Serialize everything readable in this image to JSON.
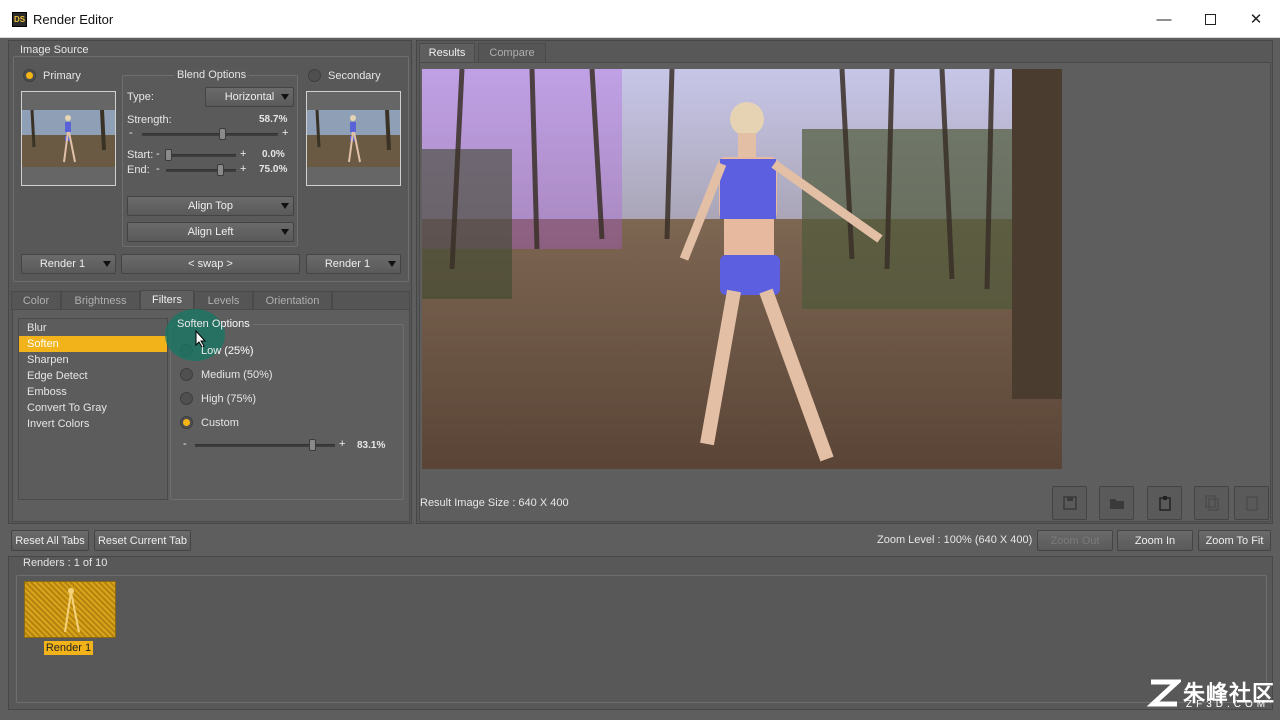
{
  "window": {
    "title": "Render Editor",
    "icon_text": "DS",
    "controls": [
      "minimize-icon",
      "maximize-icon",
      "close-icon"
    ]
  },
  "image_source": {
    "label": "Image Source",
    "primary_label": "Primary",
    "secondary_label": "Secondary",
    "blend": {
      "label": "Blend Options",
      "type_label": "Type:",
      "type_value": "Horizontal",
      "strength_label": "Strength:",
      "strength_value": "58.7%",
      "start_label": "Start:",
      "start_value": "0.0%",
      "end_label": "End:",
      "end_value": "75.0%",
      "align_top": "Align Top",
      "align_left": "Align Left"
    },
    "primary_render": "Render 1",
    "swap_label": "< swap >",
    "secondary_render": "Render 1"
  },
  "tabs": [
    "Color",
    "Brightness",
    "Filters",
    "Levels",
    "Orientation"
  ],
  "active_tab": "Filters",
  "filters": {
    "items": [
      "Blur",
      "Soften",
      "Sharpen",
      "Edge Detect",
      "Emboss",
      "Convert To Gray",
      "Invert Colors"
    ],
    "selected": "Soften",
    "options_label": "Soften Options",
    "options": [
      "Low (25%)",
      "Medium (50%)",
      "High (75%)",
      "Custom"
    ],
    "selected_option": "Custom",
    "custom_value": "83.1%"
  },
  "results": {
    "tabs": [
      "Results",
      "Compare"
    ],
    "active": "Results",
    "size_text": "Result Image Size : 640 X 400",
    "toolbar_icons": [
      "save-icon",
      "open-folder-icon",
      "paste-icon",
      "copy-icon",
      "clipboard-icon"
    ]
  },
  "bottom": {
    "reset_all": "Reset All Tabs",
    "reset_current": "Reset Current Tab",
    "zoom_level": "Zoom Level : 100% (640 X 400)",
    "zoom_out": "Zoom Out",
    "zoom_in": "Zoom In",
    "zoom_fit": "Zoom To Fit"
  },
  "renders": {
    "label": "Renders : 1 of 10",
    "items": [
      "Render 1"
    ]
  },
  "watermark": {
    "text": "朱峰社区",
    "sub": "ZF3D.COM"
  }
}
